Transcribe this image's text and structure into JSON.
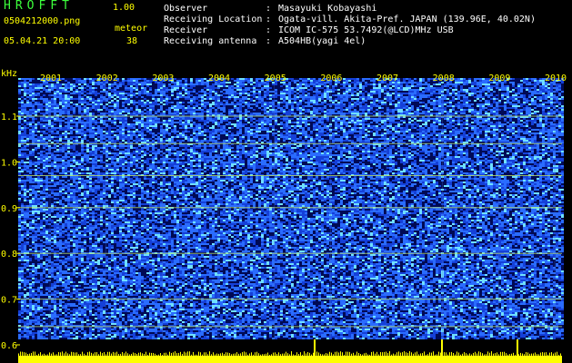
{
  "app": {
    "title": "HROFFT",
    "version": "1.00"
  },
  "file": {
    "name": "0504212000.png",
    "datetime": "05.04.21 20:00"
  },
  "meteor": {
    "label": "meteor",
    "count": "38"
  },
  "info": [
    {
      "label": "Observer",
      "value": "Masayuki Kobayashi"
    },
    {
      "label": "Receiving Location",
      "value": "Ogata-vill. Akita-Pref. JAPAN (139.96E, 40.02N)"
    },
    {
      "label": "Receiver",
      "value": "ICOM IC-575 53.7492(@LCD)MHz USB"
    },
    {
      "label": "Receiving antenna",
      "value": "A504HB(yagi 4el)"
    }
  ],
  "spectrogram": {
    "unit": "kHz",
    "y_ticks": [
      "1.1",
      "1.0",
      "0.9",
      "0.8",
      "0.7",
      "0.6"
    ],
    "x_ticks": [
      "2001",
      "2002",
      "2003",
      "2004",
      "2005",
      "2006",
      "2007",
      "2008",
      "2009",
      "2010"
    ],
    "colors": {
      "background": "#000000",
      "labels": "#ffff00",
      "low": "#0a1a9a",
      "mid": "#2a6cff",
      "high": "#6fe0ff",
      "line": "#b8e06a"
    }
  }
}
